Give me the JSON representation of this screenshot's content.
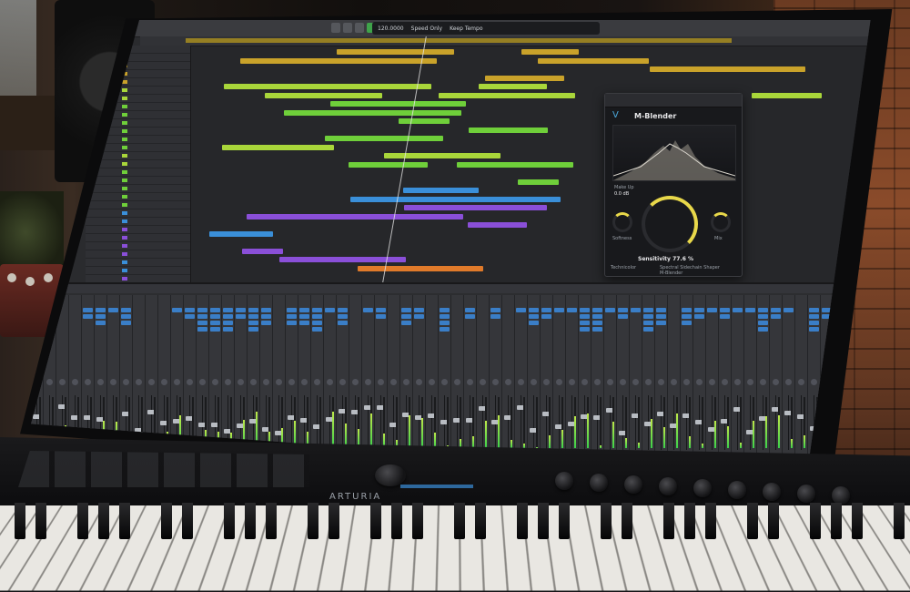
{
  "scene": "Photo of a studio monitor showing a DAW arrangement, a mixer and a plugin window, with a MIDI keyboard in front",
  "keyboard": {
    "brand": "ARTURIA"
  },
  "plugin": {
    "title": "M-Blender",
    "sensitivity_label": "Sensitivity",
    "sensitivity_value": "77.6 %",
    "makeup_label": "Make Up",
    "makeup_value": "0.0 dB",
    "softness_label": "Softness",
    "mix_label": "Mix",
    "technicolor_label": "Technicolor",
    "shaper_label": "Spectral Sidechain Shaper",
    "footer_label": "M-Blender"
  },
  "lcd": {
    "speed_label": "Speed Only",
    "tempo": "120.0000",
    "key_tempo": "Keep Tempo"
  },
  "colors": {
    "region_green": "#6fcf3a",
    "region_lime": "#a9d63a",
    "region_yellow": "#c9a22a",
    "region_blue": "#3a8fd9",
    "region_purple": "#8a4fd8",
    "region_orange": "#e07a2a",
    "insert_blue": "#3a7ec7",
    "meter_green": "#3bd14a",
    "sensitivity_arc": "#e8d84a"
  }
}
